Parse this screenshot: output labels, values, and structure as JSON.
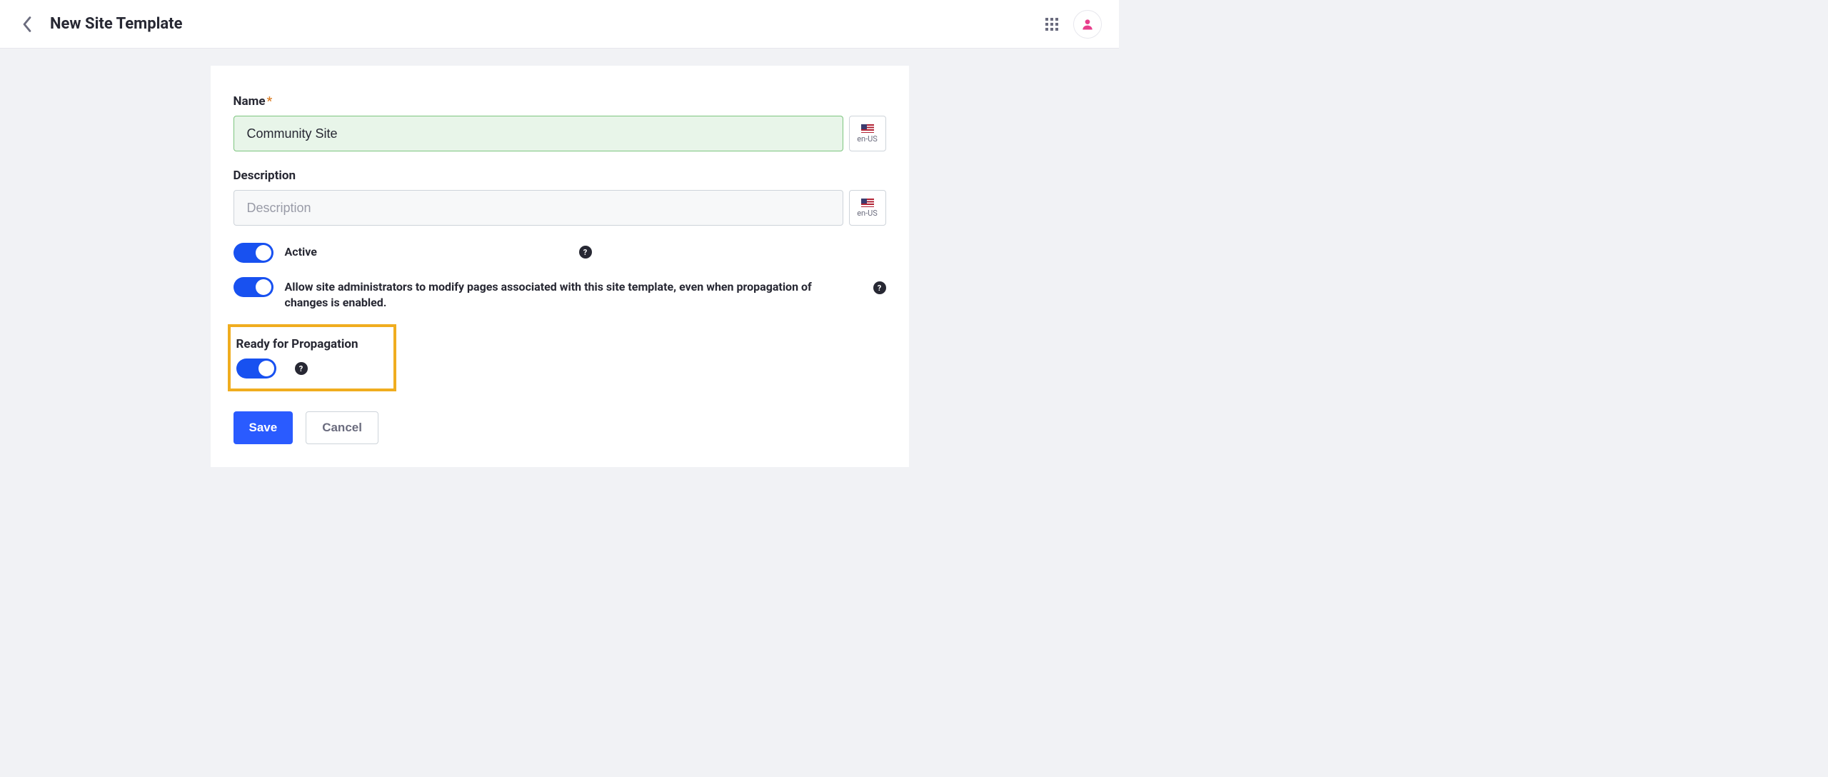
{
  "header": {
    "title": "New Site Template",
    "locale": "en-US"
  },
  "form": {
    "name_label": "Name",
    "name_value": "Community Site",
    "description_label": "Description",
    "description_placeholder": "Description",
    "active_label": "Active",
    "allow_modify_label": "Allow site administrators to modify pages associated with this site template, even when propagation of changes is enabled.",
    "propagation_label": "Ready for Propagation"
  },
  "buttons": {
    "save": "Save",
    "cancel": "Cancel"
  }
}
